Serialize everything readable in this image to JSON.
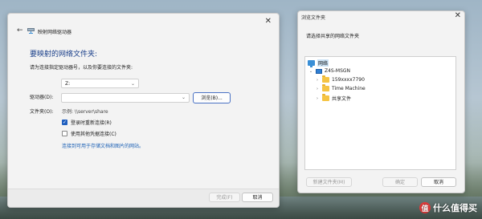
{
  "wizard": {
    "title": "映射网络驱动器",
    "heading": "要映射的网络文件夹:",
    "description": "请为连接指定驱动器号，以及你要连接的文件夹:",
    "drive_label": "驱动器(D):",
    "drive_value": "Z:",
    "folder_label": "文件夹(O):",
    "folder_value": "",
    "browse_label": "浏览(B)...",
    "example": "示例: \\\\server\\share",
    "reconnect_label": "登录时重新连接(R)",
    "reconnect_checked": true,
    "other_creds_label": "使用其他凭据连接(C)",
    "other_creds_checked": false,
    "link_text": "连接到可用于存储文档和图片的网站。",
    "finish_label": "完成(F)",
    "cancel_label": "取消"
  },
  "browse": {
    "title": "浏览文件夹",
    "prompt": "请选择共享的网络文件夹",
    "tree": {
      "root": "网络",
      "computer": "Z4S-MSGN",
      "folders": [
        "159xxxx7790",
        "Time Machine",
        "共享文件"
      ]
    },
    "new_folder_label": "新建文件夹(M)",
    "ok_label": "确定",
    "cancel_label": "取消"
  },
  "watermark": {
    "badge": "值",
    "text": "什么值得买"
  },
  "colors": {
    "accent": "#1f5fbf",
    "heading": "#1a3f8a",
    "link": "#1a5fb4",
    "folder": "#f5c443"
  }
}
